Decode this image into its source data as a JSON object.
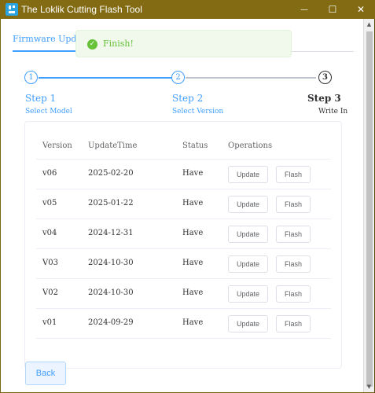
{
  "window": {
    "title": "The Loklik Cutting Flash Tool",
    "minimize_glyph": "—",
    "maximize_glyph": "☐",
    "close_glyph": "✕"
  },
  "tabs": [
    {
      "label": "Firmware Update",
      "active": true
    }
  ],
  "toast": {
    "text": "Finish!",
    "icon": "check-circle-icon",
    "color": "#67c23a"
  },
  "steps": [
    {
      "number": "1",
      "title": "Step 1",
      "description": "Select Model",
      "state": "done"
    },
    {
      "number": "2",
      "title": "Step 2",
      "description": "Select Version",
      "state": "done"
    },
    {
      "number": "3",
      "title": "Step 3",
      "description": "Write In",
      "state": "current"
    }
  ],
  "table": {
    "headers": {
      "version": "Version",
      "time": "UpdateTime",
      "status": "Status",
      "operations": "Operations"
    },
    "update_label": "Update",
    "flash_label": "Flash",
    "rows": [
      {
        "version": "v06",
        "time": "2025-02-20",
        "status": "Have"
      },
      {
        "version": "v05",
        "time": "2025-01-22",
        "status": "Have"
      },
      {
        "version": "v04",
        "time": "2024-12-31",
        "status": "Have"
      },
      {
        "version": "V03",
        "time": "2024-10-30",
        "status": "Have"
      },
      {
        "version": "V02",
        "time": "2024-10-30",
        "status": "Have"
      },
      {
        "version": "v01",
        "time": "2024-09-29",
        "status": "Have"
      }
    ]
  },
  "back_label": "Back",
  "colors": {
    "accent": "#409eff",
    "titlebar": "#826b12",
    "success": "#67c23a"
  }
}
